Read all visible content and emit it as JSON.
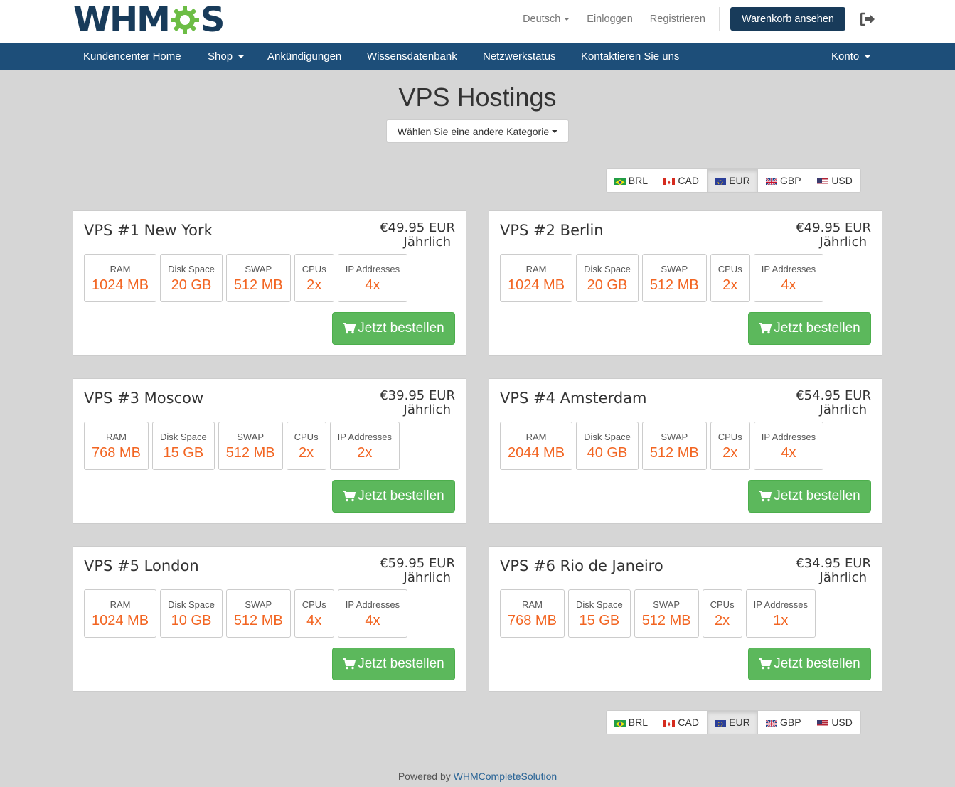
{
  "header": {
    "logo_text_a": "WHM",
    "logo_text_b": "S",
    "language": "Deutsch",
    "login": "Einloggen",
    "register": "Registrieren",
    "cart_button": "Warenkorb ansehen"
  },
  "nav": {
    "home": "Kundencenter Home",
    "shop": "Shop",
    "announcements": "Ankündigungen",
    "knowledgebase": "Wissensdatenbank",
    "network_status": "Netzwerkstatus",
    "contact": "Kontaktieren Sie uns",
    "account": "Konto"
  },
  "page": {
    "title": "VPS Hostings",
    "category_button": "Wählen Sie eine andere Kategorie"
  },
  "currencies": [
    "BRL",
    "CAD",
    "EUR",
    "GBP",
    "USD"
  ],
  "active_currency": "EUR",
  "order_button": "Jetzt bestellen",
  "feature_labels": [
    "RAM",
    "Disk Space",
    "SWAP",
    "CPUs",
    "IP Addresses"
  ],
  "products": [
    {
      "name": "VPS #1 New York",
      "price": "€49.95 EUR",
      "cycle": "Jährlich",
      "features": [
        "1024 MB",
        "20 GB",
        "512 MB",
        "2x",
        "4x"
      ]
    },
    {
      "name": "VPS #2 Berlin",
      "price": "€49.95 EUR",
      "cycle": "Jährlich",
      "features": [
        "1024 MB",
        "20 GB",
        "512 MB",
        "2x",
        "4x"
      ]
    },
    {
      "name": "VPS #3 Moscow",
      "price": "€39.95 EUR",
      "cycle": "Jährlich",
      "features": [
        "768 MB",
        "15 GB",
        "512 MB",
        "2x",
        "2x"
      ]
    },
    {
      "name": "VPS #4 Amsterdam",
      "price": "€54.95 EUR",
      "cycle": "Jährlich",
      "features": [
        "2044 MB",
        "40 GB",
        "512 MB",
        "2x",
        "4x"
      ]
    },
    {
      "name": "VPS #5 London",
      "price": "€59.95 EUR",
      "cycle": "Jährlich",
      "features": [
        "1024 MB",
        "10 GB",
        "512 MB",
        "4x",
        "4x"
      ]
    },
    {
      "name": "VPS #6 Rio de Janeiro",
      "price": "€34.95 EUR",
      "cycle": "Jährlich",
      "features": [
        "768 MB",
        "15 GB",
        "512 MB",
        "2x",
        "1x"
      ]
    }
  ],
  "footer": {
    "prefix": "Powered by",
    "link": "WHMCompleteSolution"
  },
  "colors": {
    "navbar": "#1d4e79",
    "brand_dark": "#183b5a",
    "order_green": "#5cb85c",
    "feature_value": "#f26522",
    "background": "#d6d6d6"
  }
}
